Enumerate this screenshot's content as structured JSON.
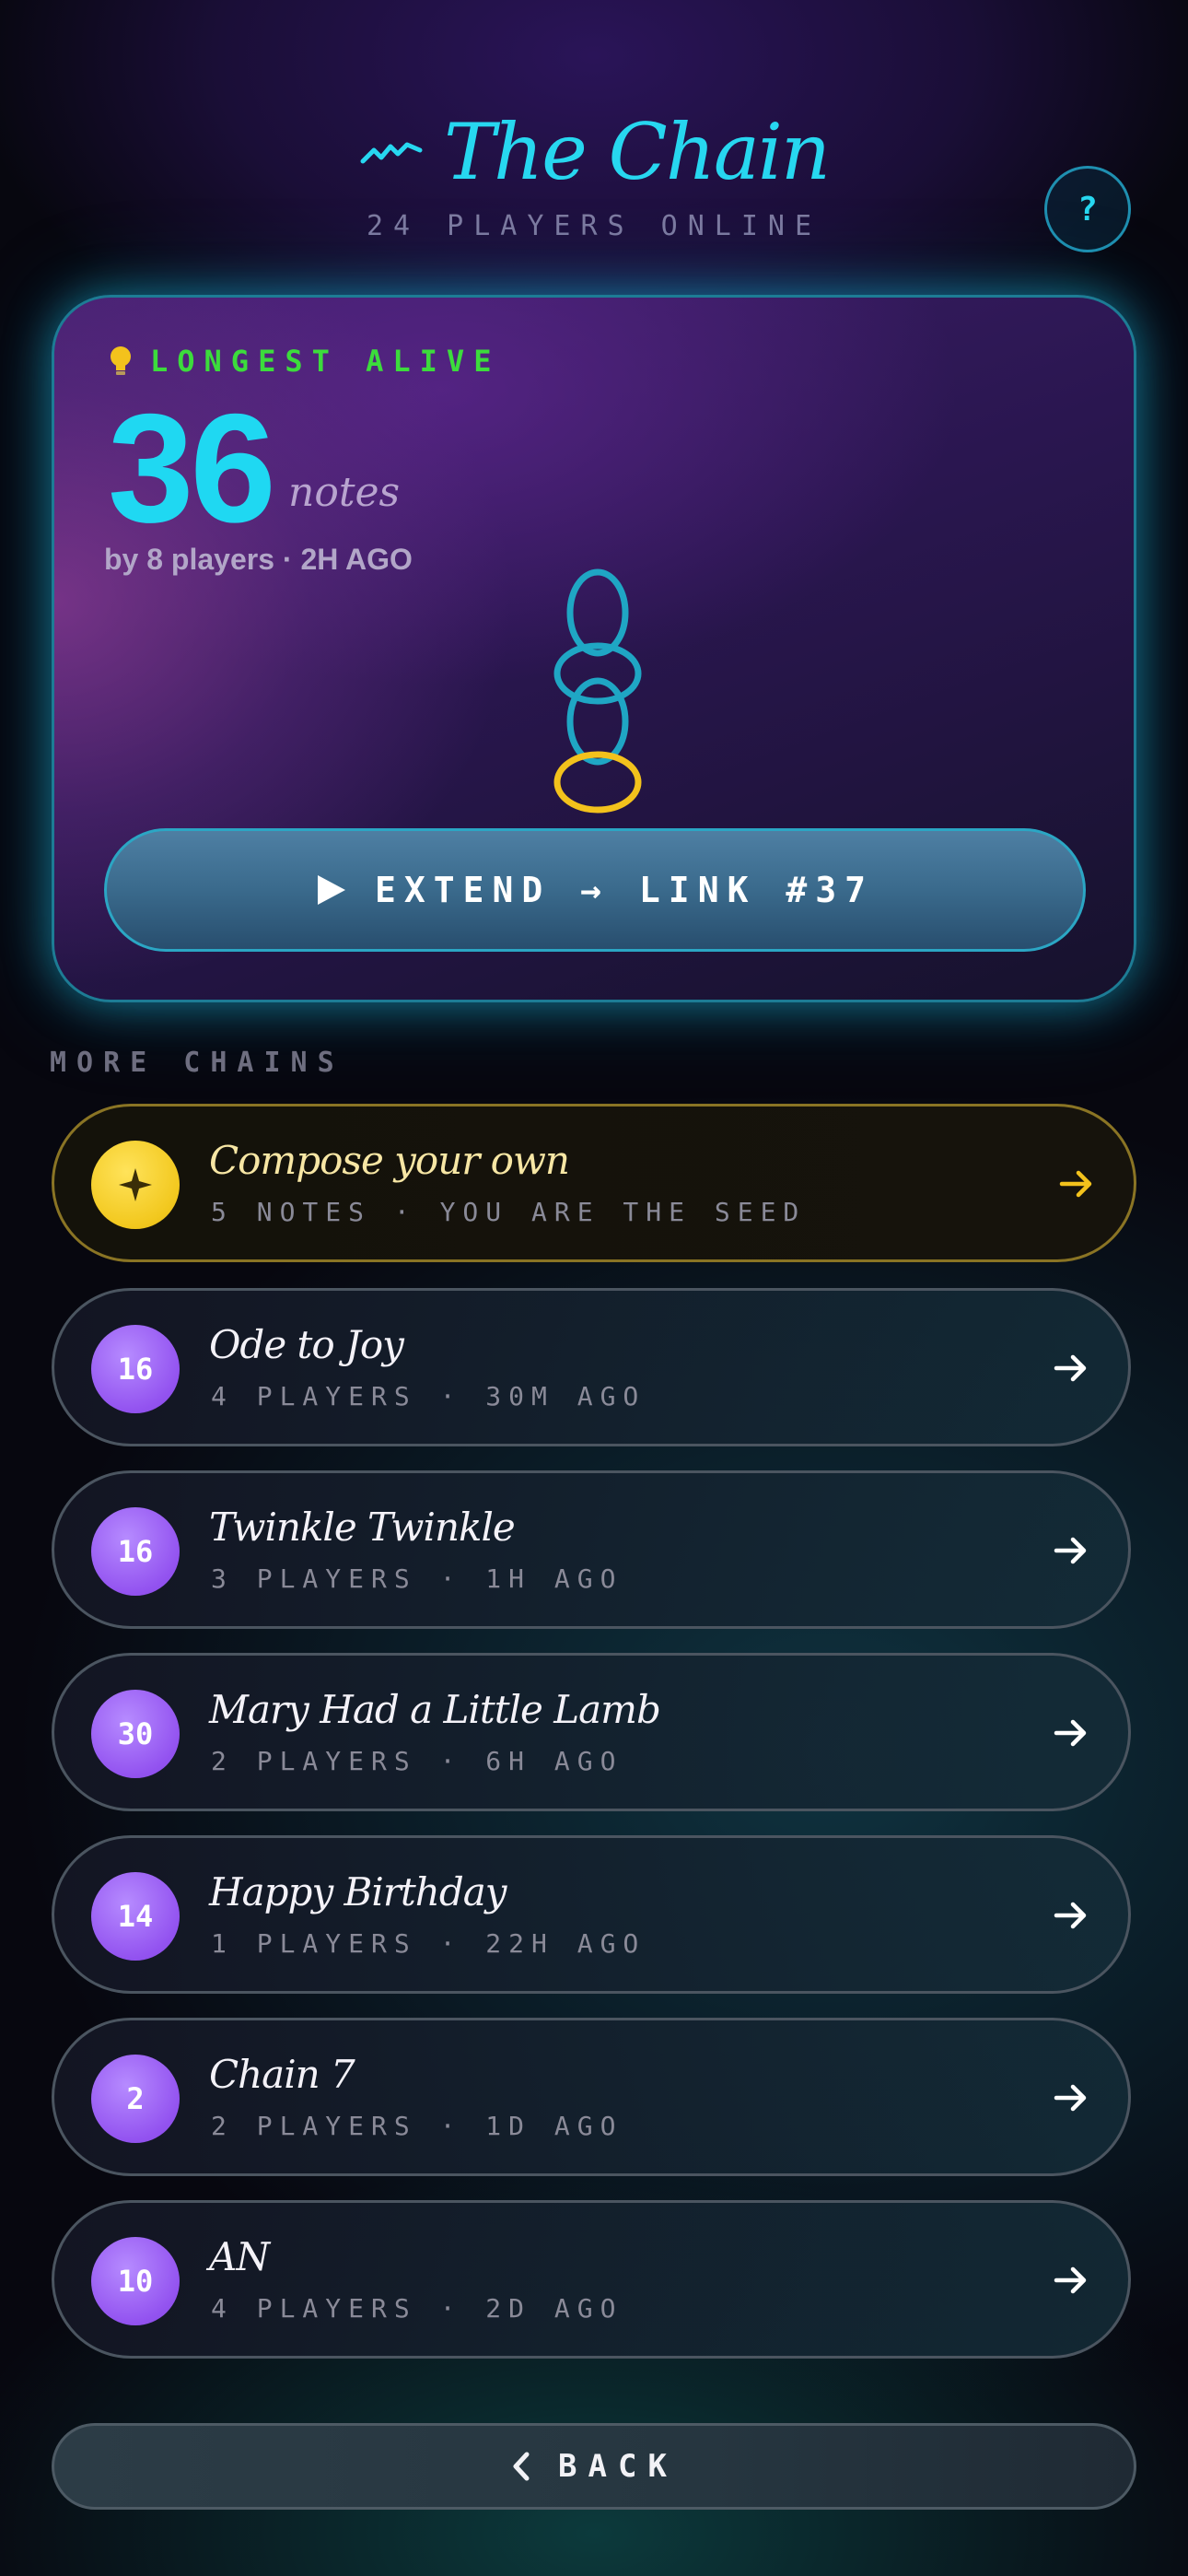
{
  "header": {
    "logo_icon": "squiggle-line-icon",
    "title": "The Chain",
    "players_online": "24 PLAYERS ONLINE",
    "help_label": "?"
  },
  "hero": {
    "badge_icon": "lightbulb-icon",
    "label": "LONGEST ALIVE",
    "note_count": "36",
    "notes_word": "notes",
    "by_line": "by 8 players · 2H AGO",
    "chain_graphic": "linked-rings-icon",
    "extend_label": "EXTEND → LINK #37",
    "accent_color": "#27d7f0",
    "label_color": "#3cdc3c"
  },
  "more_chains": {
    "section_label": "MORE CHAINS",
    "compose": {
      "icon": "sparkle-icon",
      "title": "Compose your own",
      "subtitle": "5 NOTES · YOU ARE THE SEED"
    },
    "items": [
      {
        "count": "16",
        "title": "Ode to Joy",
        "subtitle": "4 PLAYERS · 30M AGO"
      },
      {
        "count": "16",
        "title": "Twinkle Twinkle",
        "subtitle": "3 PLAYERS · 1H AGO"
      },
      {
        "count": "30",
        "title": "Mary Had a Little Lamb",
        "subtitle": "2 PLAYERS · 6H AGO"
      },
      {
        "count": "14",
        "title": "Happy Birthday",
        "subtitle": "1 PLAYERS · 22H AGO"
      },
      {
        "count": "2",
        "title": "Chain 7",
        "subtitle": "2 PLAYERS · 1D AGO"
      },
      {
        "count": "10",
        "title": "AN",
        "subtitle": "4 PLAYERS · 2D AGO"
      }
    ]
  },
  "footer": {
    "back_label": "BACK"
  }
}
